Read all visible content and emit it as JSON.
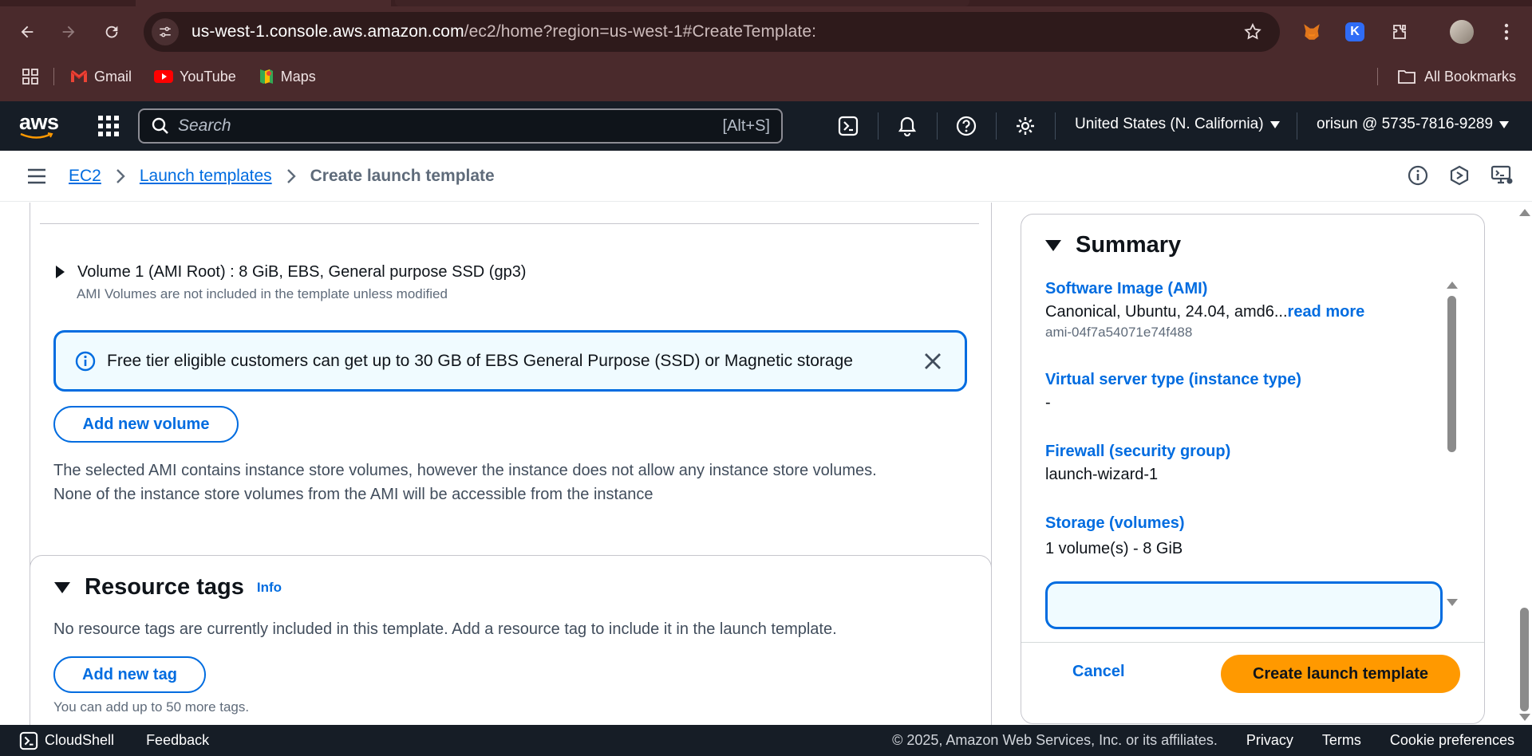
{
  "browser": {
    "url_host": "us-west-1.console.aws.amazon.com",
    "url_path": "/ec2/home?region=us-west-1#CreateTemplate:",
    "bookmarks": [
      {
        "label": "Gmail"
      },
      {
        "label": "YouTube"
      },
      {
        "label": "Maps"
      }
    ],
    "all_bookmarks": "All Bookmarks",
    "extension_k_letter": "K"
  },
  "aws_nav": {
    "logo_text": "aws",
    "search_placeholder": "Search",
    "search_shortcut": "[Alt+S]",
    "region": "United States (N. California)",
    "account": "orisun @ 5735-7816-9289"
  },
  "breadcrumb": {
    "items": [
      "EC2",
      "Launch templates"
    ],
    "current": "Create launch template"
  },
  "storage": {
    "volume_title": "Volume 1 (AMI Root) : 8 GiB, EBS, General purpose SSD (gp3)",
    "volume_subtitle": "AMI Volumes are not included in the template unless modified",
    "alert_text": "Free tier eligible customers can get up to 30 GB of EBS General Purpose (SSD) or Magnetic storage",
    "add_volume_label": "Add new volume",
    "note_line1": "The selected AMI contains instance store volumes, however the instance does not allow any instance store volumes.",
    "note_line2": "None of the instance store volumes from the AMI will be accessible from the instance"
  },
  "resource_tags": {
    "title": "Resource tags",
    "info_label": "Info",
    "description": "No resource tags are currently included in this template. Add a resource tag to include it in the launch template.",
    "add_tag_label": "Add new tag",
    "limit_note": "You can add up to 50 more tags."
  },
  "summary": {
    "title": "Summary",
    "ami_label": "Software Image (AMI)",
    "ami_value": "Canonical, Ubuntu, 24.04, amd6...",
    "ami_read_more": "read more",
    "ami_id": "ami-04f7a54071e74f488",
    "instance_type_label": "Virtual server type (instance type)",
    "instance_type_value": "-",
    "firewall_label": "Firewall (security group)",
    "firewall_value": "launch-wizard-1",
    "storage_label": "Storage (volumes)",
    "storage_value": "1 volume(s) - 8 GiB",
    "cancel_label": "Cancel",
    "create_label": "Create launch template"
  },
  "footer": {
    "cloudshell": "CloudShell",
    "feedback": "Feedback",
    "copyright": "© 2025, Amazon Web Services, Inc. or its affiliates.",
    "privacy": "Privacy",
    "terms": "Terms",
    "cookies": "Cookie preferences"
  },
  "colors": {
    "link_blue": "#006ce0",
    "primary_orange": "#ff9900",
    "aws_nav_bg": "#161d26",
    "browser_bg": "#4a2a2c"
  }
}
